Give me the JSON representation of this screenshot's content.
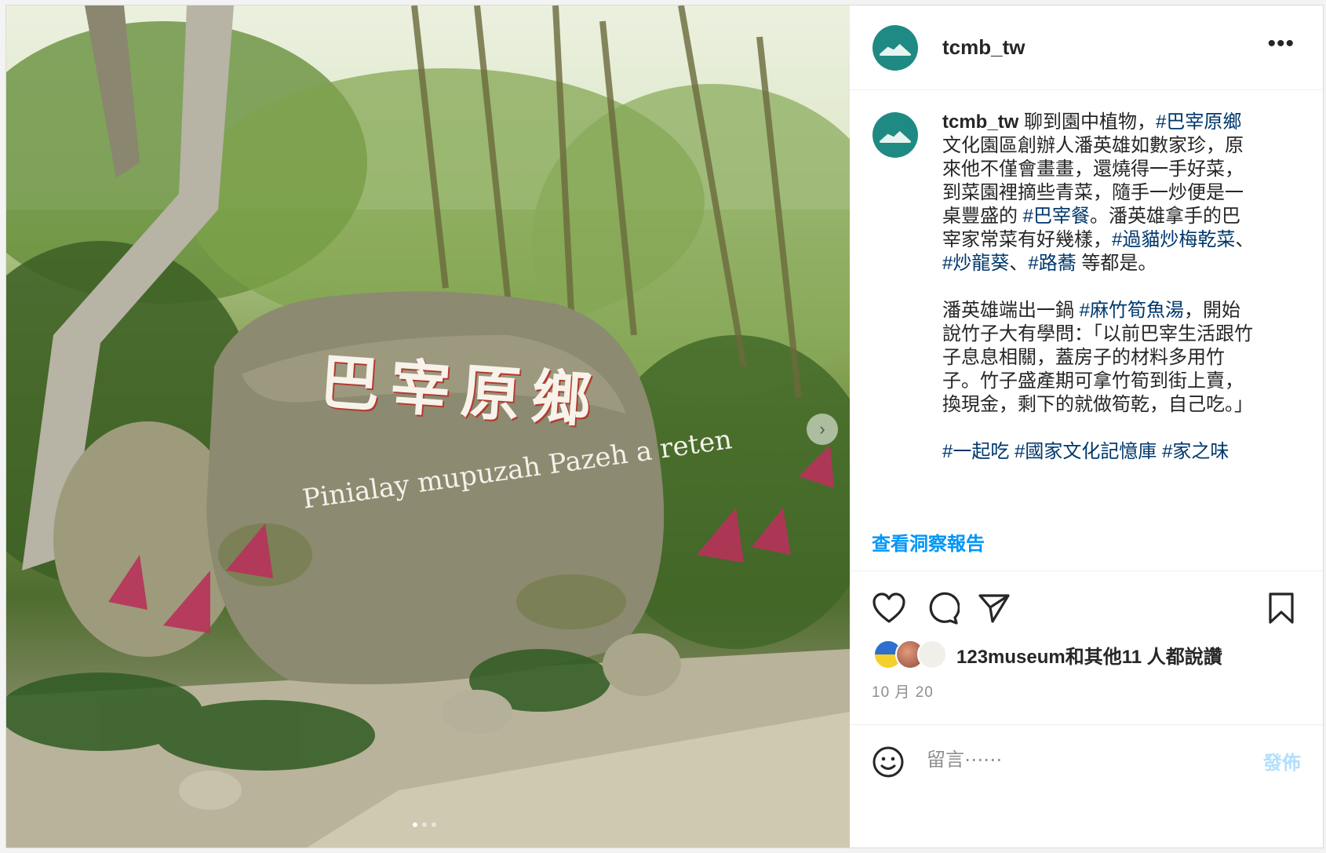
{
  "post": {
    "username": "tcmb_tw",
    "more_icon": "more-horizontal-icon",
    "photo": {
      "sign_title": "巴宰原鄉",
      "sign_subtitle": "Pinialay mupuzah Pazeh a reten",
      "next_icon": "chevron-right-icon"
    },
    "caption": {
      "username": "tcmb_tw",
      "segments": [
        {
          "text": " 聊到園中植物，",
          "tag": false
        },
        {
          "text": "#巴宰原鄉",
          "tag": true
        },
        {
          "text": " 文化園區創辦人潘英雄如數家珍，原來他不僅會畫畫，還燒得一手好菜，到菜園裡摘些青菜，隨手一炒便是一桌豐盛的 ",
          "tag": false
        },
        {
          "text": "#巴宰餐",
          "tag": true
        },
        {
          "text": "。潘英雄拿手的巴宰家常菜有好幾樣，",
          "tag": false
        },
        {
          "text": "#過貓炒梅乾菜",
          "tag": true
        },
        {
          "text": "、",
          "tag": false
        },
        {
          "text": "#炒龍葵",
          "tag": true
        },
        {
          "text": "、",
          "tag": false
        },
        {
          "text": "#路蕎",
          "tag": true
        },
        {
          "text": " 等都是。\n\n潘英雄端出一鍋 ",
          "tag": false
        },
        {
          "text": "#麻竹筍魚湯",
          "tag": true
        },
        {
          "text": "，開始說竹子大有學問：「以前巴宰生活跟竹子息息相關，蓋房子的材料多用竹子。竹子盛產期可拿竹筍到街上賣，換現金，剩下的就做筍乾，自己吃。」\n\n",
          "tag": false
        },
        {
          "text": "#一起吃",
          "tag": true
        },
        {
          "text": " ",
          "tag": false
        },
        {
          "text": "#國家文化記憶庫",
          "tag": true
        },
        {
          "text": " ",
          "tag": false
        },
        {
          "text": "#家之味",
          "tag": true
        }
      ]
    },
    "insights_label": "查看洞察報告",
    "actions": {
      "like_icon": "heart-icon",
      "comment_icon": "comment-icon",
      "share_icon": "send-icon",
      "save_icon": "bookmark-icon"
    },
    "likes_text": "123museum和其他11 人都說讚",
    "date": "10 月 20",
    "comment": {
      "emoji_icon": "smiley-icon",
      "placeholder": "留言⋯⋯",
      "post_label": "發佈"
    },
    "colors": {
      "link": "#00376b",
      "accent": "#0095f6",
      "post_disabled": "#b2dffc",
      "brand": "#1f8a84"
    }
  }
}
